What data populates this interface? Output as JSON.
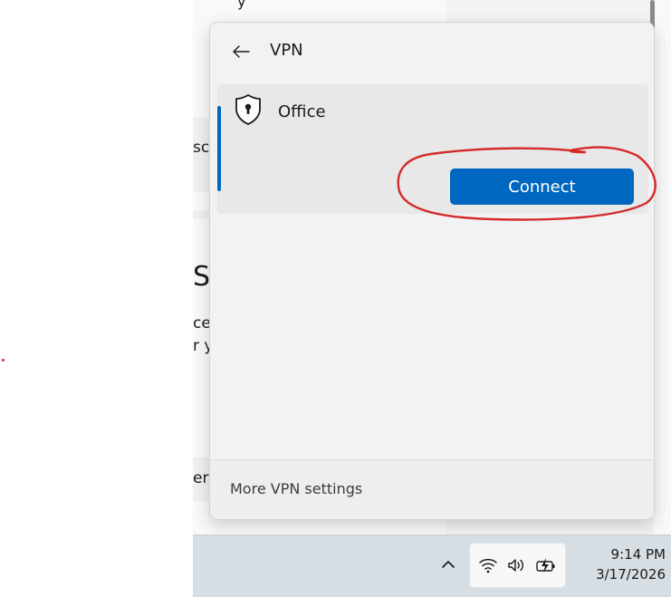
{
  "background_window": {
    "partial_texts": [
      "scr",
      "SS",
      "ce",
      "r y",
      "er"
    ],
    "top_fragment": "y"
  },
  "vpn_flyout": {
    "title": "VPN",
    "back_icon": "arrow-left-icon",
    "connections": [
      {
        "name": "Office",
        "icon": "shield-keyhole-icon",
        "selected": true,
        "action_label": "Connect"
      }
    ],
    "footer_link": "More VPN settings",
    "accent_color": "#0067c0",
    "annotation_color": "#d42a2a"
  },
  "taskbar": {
    "tray_icons": [
      "chevron-up-icon",
      "wifi-icon",
      "volume-icon",
      "battery-charging-icon"
    ],
    "time": "9:14 PM",
    "date": "3/17/2026"
  }
}
